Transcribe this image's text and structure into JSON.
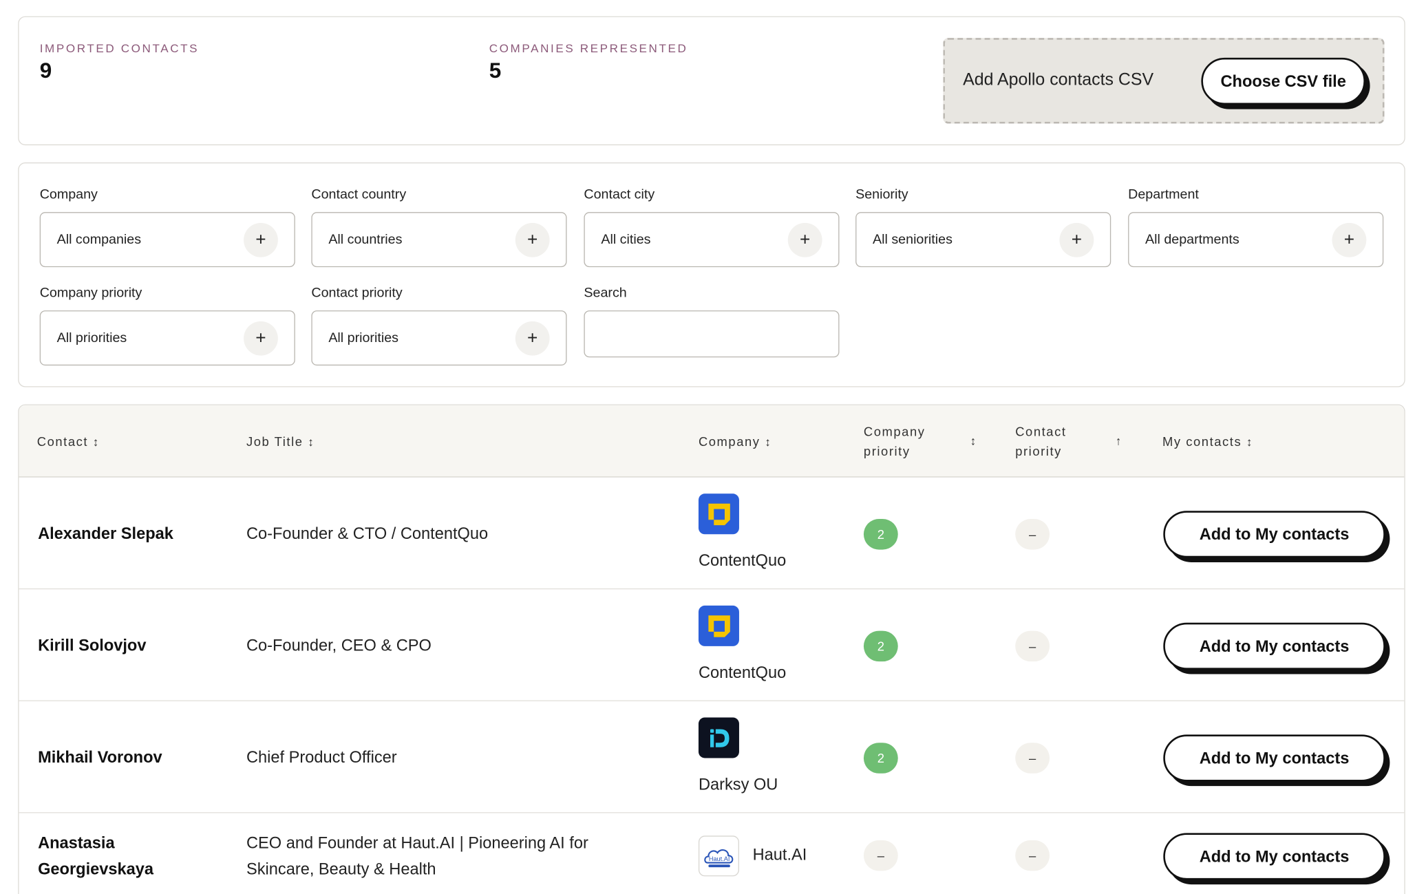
{
  "stats": {
    "imported_label": "IMPORTED CONTACTS",
    "imported_value": "9",
    "companies_label": "COMPANIES REPRESENTED",
    "companies_value": "5",
    "upload_label": "Add Apollo contacts CSV",
    "choose_button": "Choose CSV file"
  },
  "filters": {
    "company": {
      "label": "Company",
      "value": "All companies"
    },
    "country": {
      "label": "Contact country",
      "value": "All countries"
    },
    "city": {
      "label": "Contact city",
      "value": "All cities"
    },
    "seniority": {
      "label": "Seniority",
      "value": "All seniorities"
    },
    "department": {
      "label": "Department",
      "value": "All departments"
    },
    "company_priority": {
      "label": "Company priority",
      "value": "All priorities"
    },
    "contact_priority": {
      "label": "Contact priority",
      "value": "All priorities"
    },
    "search": {
      "label": "Search",
      "value": "",
      "placeholder": ""
    },
    "plus_glyph": "+"
  },
  "table": {
    "headers": {
      "contact": "Contact",
      "job_title": "Job Title",
      "company": "Company",
      "company_priority_1": "Company",
      "company_priority_2": "priority",
      "contact_priority_1": "Contact",
      "contact_priority_2": "priority",
      "my_contacts": "My contacts"
    },
    "sort_glyphs": {
      "both": "↕",
      "up": "↑"
    },
    "rows": [
      {
        "name_1": "Alexander Slepak",
        "name_2": "",
        "title_1": "Co-Founder & CTO / ContentQuo",
        "title_2": "",
        "company": "ContentQuo",
        "company_logo": "contentquo-logo-icon",
        "company_priority": "2",
        "contact_priority": "–",
        "action": "Add to My contacts"
      },
      {
        "name_1": "Kirill Solovjov",
        "name_2": "",
        "title_1": "Co-Founder, CEO & CPO",
        "title_2": "",
        "company": "ContentQuo",
        "company_logo": "contentquo-logo-icon",
        "company_priority": "2",
        "contact_priority": "–",
        "action": "Add to My contacts"
      },
      {
        "name_1": "Mikhail Voronov",
        "name_2": "",
        "title_1": "Chief Product Officer",
        "title_2": "",
        "company": "Darksy OU",
        "company_logo": "darksy-logo-icon",
        "company_priority": "2",
        "contact_priority": "–",
        "action": "Add to My contacts"
      },
      {
        "name_1": "Anastasia",
        "name_2": "Georgievskaya",
        "title_1": "CEO and Founder at Haut.AI | Pioneering AI for",
        "title_2": "Skincare, Beauty & Health",
        "company": "Haut.AI",
        "company_logo": "hautai-logo-icon",
        "logo_text": "Haut.AI",
        "company_priority": "–",
        "contact_priority": "–",
        "action": "Add to My contacts"
      }
    ]
  },
  "colors": {
    "priority_green": "#6fbe73",
    "stat_label": "#8c5a7a",
    "contentquo_blue": "#2b5fd9",
    "contentquo_yellow": "#f5c400",
    "darksy_cyan": "#31c8ea"
  }
}
